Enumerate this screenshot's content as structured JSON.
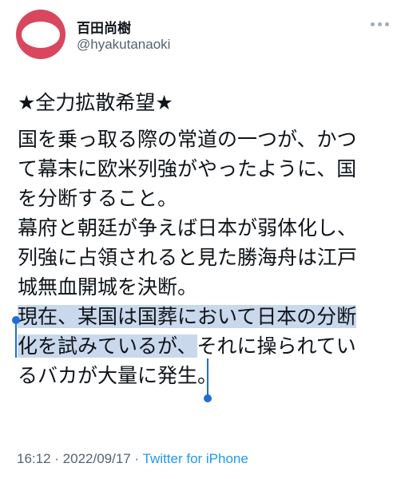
{
  "author": {
    "display_name": "百田尚樹",
    "handle": "@hyakutanaoki"
  },
  "tweet": {
    "header": "★全力拡散希望★",
    "line1": "国を乗っ取る際の常道の一つが、かつ",
    "line2": "て幕末に欧米列強がやったように、国",
    "line3": "を分断すること。",
    "line4": "幕府と朝廷が争えば日本が弱体化し、",
    "line5": "列強に占領されると見た勝海舟は江戸",
    "line6": "城無血開城を決断。",
    "line7": "現在、某国は国葬において日本の分断",
    "line8_selected": "化を試みているが、",
    "line8_rest": "それに操られてい",
    "line9": "るバカが大量に発生。"
  },
  "meta": {
    "time": "16:12",
    "separator": " · ",
    "date": "2022/09/17",
    "source": "Twitter for iPhone"
  },
  "colors": {
    "avatar": "#d9475f",
    "selection": "#c9d8ec",
    "handles": "#1d6fd0",
    "link": "#1d9bf0"
  },
  "icons": [
    "more-icon",
    "selection-handle-icon"
  ]
}
